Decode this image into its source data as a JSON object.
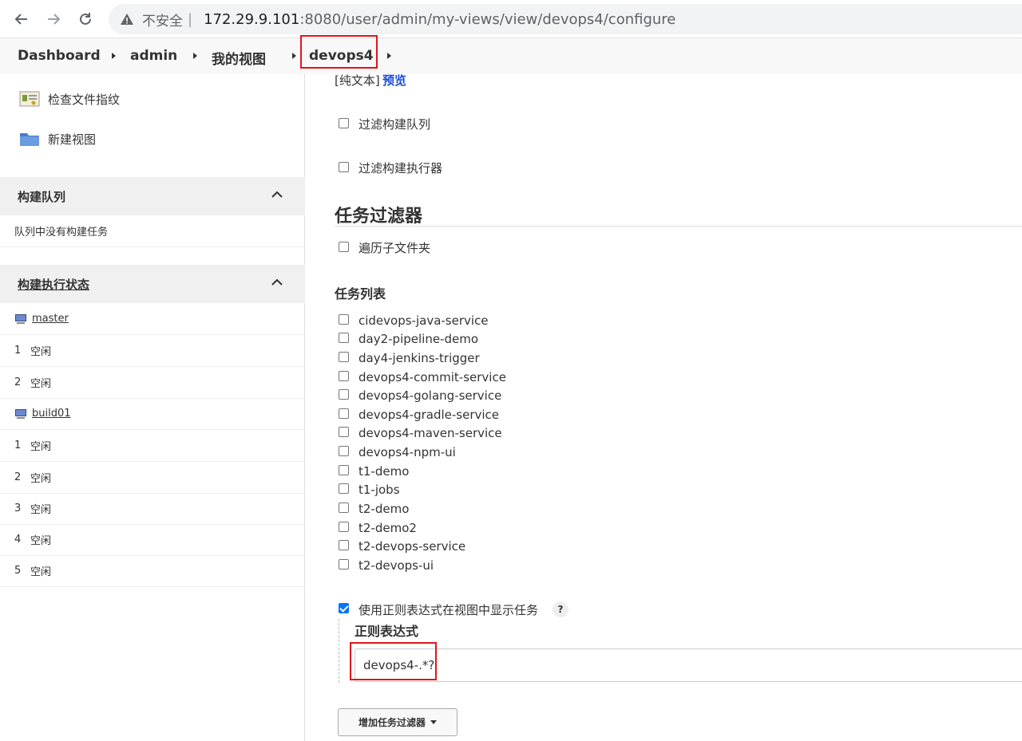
{
  "browser": {
    "insecure_label": "不安全",
    "separator": "|",
    "host": "172.29.9.101",
    "path": ":8080/user/admin/my-views/view/devops4/configure"
  },
  "breadcrumb": {
    "items": [
      "Dashboard",
      "admin",
      "我的视图",
      "devops4"
    ]
  },
  "sidebar": {
    "links": [
      "检查文件指纹",
      "新建视图"
    ],
    "build_queue": {
      "title": "构建队列",
      "empty_text": "队列中没有构建任务"
    },
    "executor_status": {
      "title": "构建执行状态",
      "nodes": [
        {
          "name": "master",
          "executors": [
            {
              "num": "1",
              "status": "空闲"
            },
            {
              "num": "2",
              "status": "空闲"
            }
          ]
        },
        {
          "name": "build01",
          "executors": [
            {
              "num": "1",
              "status": "空闲"
            },
            {
              "num": "2",
              "status": "空闲"
            },
            {
              "num": "3",
              "status": "空闲"
            },
            {
              "num": "4",
              "status": "空闲"
            },
            {
              "num": "5",
              "status": "空闲"
            }
          ]
        }
      ]
    }
  },
  "main": {
    "plain_text_label": "[纯文本]",
    "preview_link": "预览",
    "filter_queue_label": "过滤构建队列",
    "filter_executors_label": "过滤构建执行器",
    "job_filter_title": "任务过滤器",
    "recurse_label": "遍历子文件夹",
    "job_list_title": "任务列表",
    "jobs": [
      "cidevops-java-service",
      "day2-pipeline-demo",
      "day4-jenkins-trigger",
      "devops4-commit-service",
      "devops4-golang-service",
      "devops4-gradle-service",
      "devops4-maven-service",
      "devops4-npm-ui",
      "t1-demo",
      "t1-jobs",
      "t2-demo",
      "t2-demo2",
      "t2-devops-service",
      "t2-devops-ui"
    ],
    "use_regex_label": "使用正则表达式在视图中显示任务",
    "help_label": "?",
    "regex_title": "正则表达式",
    "regex_value": "devops4-.*?",
    "add_filter_button": "增加任务过滤器"
  },
  "colors": {
    "highlight": "#e0151b",
    "checkbox_checked": "#0075ff",
    "link": "#1a4ed6"
  }
}
